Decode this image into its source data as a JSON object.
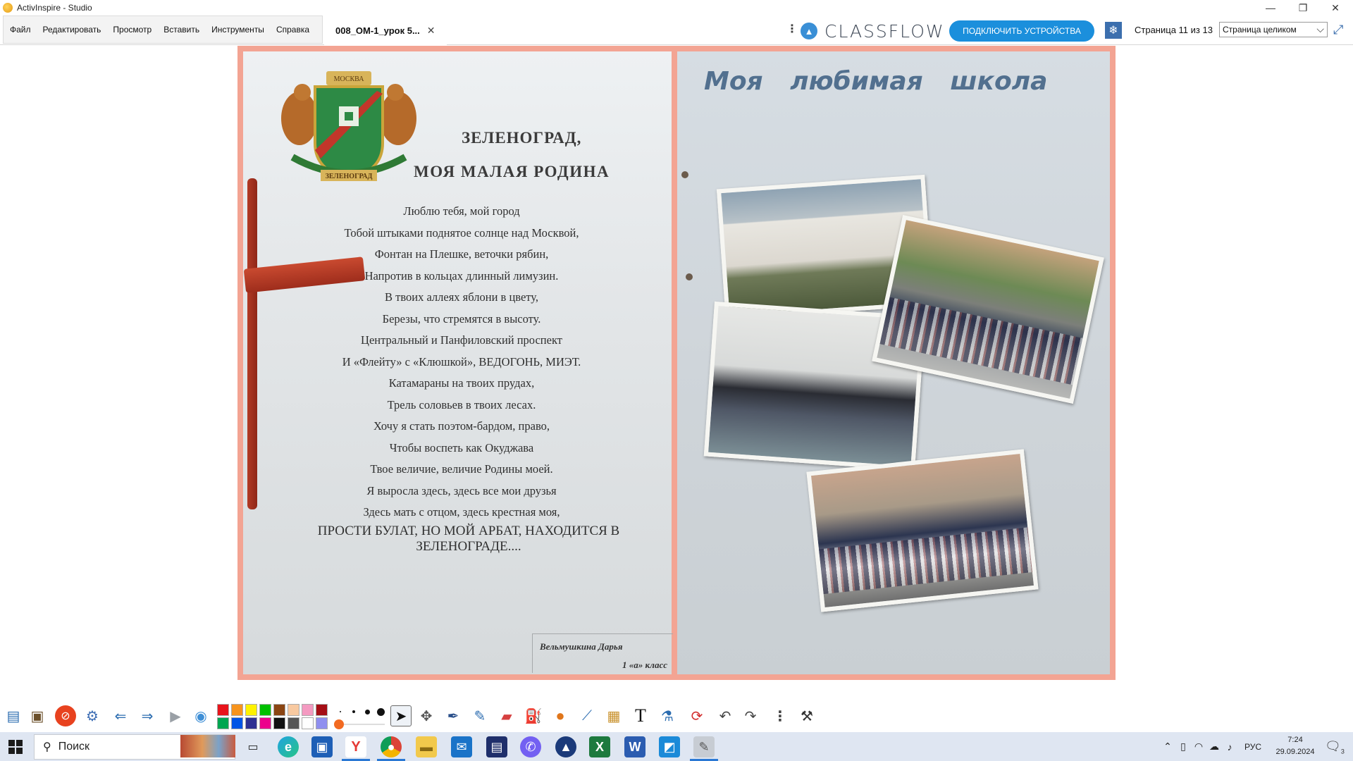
{
  "window": {
    "title": "ActivInspire - Studio",
    "minimize_glyph": "—",
    "maximize_glyph": "❐",
    "close_glyph": "✕"
  },
  "menu": [
    "Файл",
    "Редактировать",
    "Просмотр",
    "Вставить",
    "Инструменты",
    "Справка"
  ],
  "document_tab": {
    "label": "008_ОМ-1_урок 5...",
    "close_glyph": "✕"
  },
  "toolbar": {
    "classflow_logo": "CLASSFLOW",
    "connect_button": "ПОДКЛЮЧИТЬ УСТРОЙСТВА",
    "page_indicator": "Страница 11 из 13",
    "zoom_value": "Страница целиком"
  },
  "slide": {
    "left_page": {
      "title_line1": "ЗЕЛЕНОГРАД,",
      "title_line2": "МОЯ МАЛАЯ РОДИНА",
      "emblem_top": "МОСКВА",
      "emblem_bottom": "ЗЕЛЕНОГРАД",
      "poem_lines": [
        "Люблю тебя, мой город",
        "Тобой штыками поднятое солнце над Москвой,",
        "Фонтан на Плешке, веточки рябин,",
        "Напротив  в кольцах длинный лимузин.",
        "В твоих аллеях яблони в цвету,",
        "Березы, что стремятся в высоту.",
        "Центральный и Панфиловский проспект",
        "И «Флейту» с «Клюшкой», ВЕДОГОНЬ, МИЭТ.",
        "Катамараны на твоих прудах,",
        "Трель соловьев в твоих лесах.",
        "Хочу я стать поэтом-бардом, право,",
        "Чтобы воспеть как Окуджава",
        "Твое величие, величие Родины моей.",
        "Я выросла здесь, здесь все мои друзья",
        "Здесь мать с отцом, здесь крестная моя,"
      ],
      "poem_final": "ПРОСТИ БУЛАТ, НО МОЙ АРБАТ, НАХОДИТСЯ В ЗЕЛЕНОГРАДЕ....",
      "signature_name": "Вельмушкина Дарья",
      "signature_class": "1 «а» класс"
    },
    "right_page": {
      "title": "Моя любимая школа"
    }
  },
  "toolbox": {
    "colors": [
      "#e8141b",
      "#f7941d",
      "#fff200",
      "#00c000",
      "#8b4513",
      "#f8c9a0",
      "#f49ac1",
      "#a50e15",
      "#00a651",
      "#0054e6",
      "#2e3192",
      "#ec008c",
      "#111111",
      "#555555",
      "#ffffff",
      "#8f8fef"
    ]
  },
  "taskbar": {
    "search_placeholder": "Поиск",
    "language": "РУС",
    "time": "7:24",
    "date": "29.09.2024",
    "notification_count": "3"
  }
}
